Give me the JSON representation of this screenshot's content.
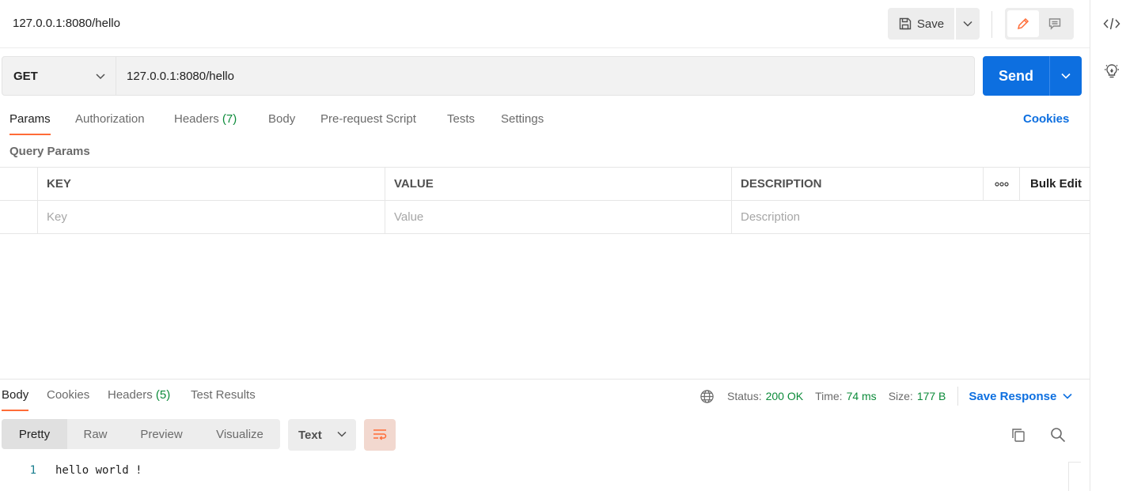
{
  "request": {
    "title": "127.0.0.1:8080/hello",
    "method": "GET",
    "url": "127.0.0.1:8080/hello"
  },
  "toolbar": {
    "save_label": "Save",
    "send_label": "Send"
  },
  "request_tabs": {
    "params": "Params",
    "authorization": "Authorization",
    "headers": "Headers",
    "headers_count": "(7)",
    "body": "Body",
    "pre_request": "Pre-request Script",
    "tests": "Tests",
    "settings": "Settings",
    "cookies": "Cookies"
  },
  "params": {
    "section_title": "Query Params",
    "columns": {
      "key": "KEY",
      "value": "VALUE",
      "description": "DESCRIPTION",
      "more": "ooo",
      "bulk_edit": "Bulk Edit"
    },
    "placeholders": {
      "key": "Key",
      "value": "Value",
      "description": "Description"
    }
  },
  "response": {
    "tabs": {
      "body": "Body",
      "cookies": "Cookies",
      "headers": "Headers",
      "headers_count": "(5)",
      "test_results": "Test Results"
    },
    "status_label": "Status:",
    "status_value": "200 OK",
    "time_label": "Time:",
    "time_value": "74 ms",
    "size_label": "Size:",
    "size_value": "177 B",
    "save_response": "Save Response",
    "view_modes": {
      "pretty": "Pretty",
      "raw": "Raw",
      "preview": "Preview",
      "visualize": "Visualize"
    },
    "format": "Text",
    "lines": [
      {
        "number": "1",
        "text": "hello world !"
      }
    ]
  },
  "colors": {
    "accent": "#ff6c37",
    "primary": "#0d6fe0",
    "success": "#0c8b3a"
  },
  "icons": [
    "save-icon",
    "chevron-down-icon",
    "edit-icon",
    "comment-icon",
    "code-icon",
    "lightbulb-icon",
    "globe-icon",
    "wrap-lines-icon",
    "copy-icon",
    "search-icon"
  ]
}
